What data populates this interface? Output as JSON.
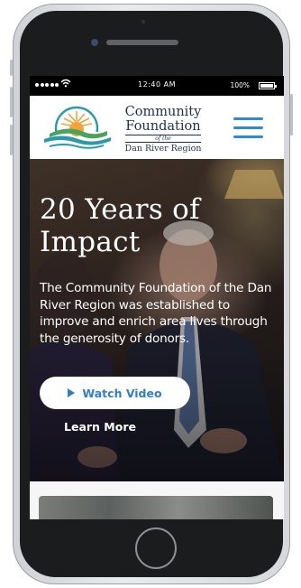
{
  "status_bar": {
    "time": "12:40 AM",
    "battery": "100%"
  },
  "header": {
    "logo": {
      "line1": "Community",
      "line2": "Foundation",
      "of_the": "of the",
      "line3": "Dan River Region"
    },
    "menu_icon": "hamburger-icon"
  },
  "hero": {
    "title": "20 Years of Impact",
    "text": "The Community Foundation of the Dan River Region was established to improve and enrich area lives through the generosity of donors.",
    "watch_video_label": "Watch Video",
    "learn_more_label": "Learn More",
    "play_icon": "play-icon"
  },
  "colors": {
    "accent_blue": "#2f8bd1",
    "logo_navy": "#1f2f4c",
    "logo_sun": "#f2a33a",
    "logo_green": "#4aa35a",
    "logo_teal": "#2a9aa8"
  }
}
